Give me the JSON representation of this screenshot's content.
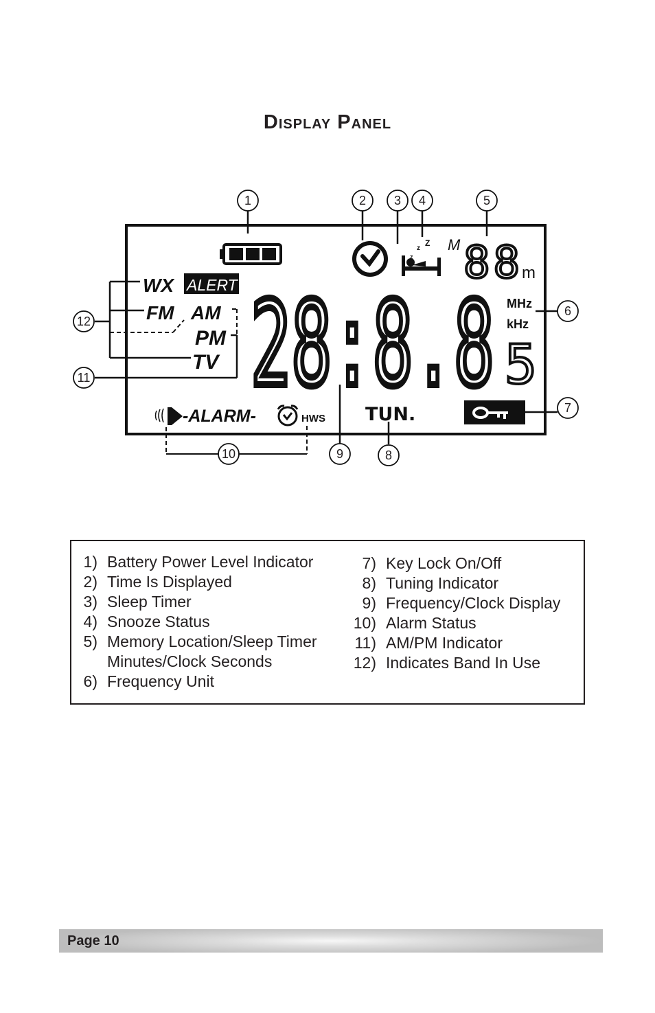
{
  "page": {
    "title": "Display Panel",
    "page_label": "Page 10"
  },
  "lcd": {
    "band_labels": {
      "wx": "WX",
      "alert": "ALERT",
      "fm": "FM",
      "am": "AM",
      "pm": "PM",
      "tv": "TV"
    },
    "main_digits": "28:8.8",
    "sub_digit": "5",
    "memory_prefix": "M",
    "memory_digits": "88",
    "memory_suffix": "m",
    "unit_mhz": "MHz",
    "unit_khz": "kHz",
    "alarm_label": "-ALARM-",
    "hws_label": "HWS",
    "tuning_label": "TUN.",
    "snooze_z": "z z Z",
    "icons": [
      "battery-icon",
      "clock-icon",
      "sleep-bed-icon",
      "speaker-icon",
      "alarm-clock-icon",
      "key-icon"
    ]
  },
  "callouts": [
    "1",
    "2",
    "3",
    "4",
    "5",
    "6",
    "7",
    "8",
    "9",
    "10",
    "11",
    "12"
  ],
  "legend": {
    "left": [
      {
        "num": "1)",
        "text": "Battery Power Level Indicator"
      },
      {
        "num": "2)",
        "text": "Time Is Displayed"
      },
      {
        "num": "3)",
        "text": "Sleep Timer"
      },
      {
        "num": "4)",
        "text": "Snooze Status"
      },
      {
        "num": "5)",
        "text": "Memory Location/Sleep Timer"
      },
      {
        "num": "",
        "text": "Minutes/Clock Seconds"
      },
      {
        "num": "6)",
        "text": "Frequency Unit"
      }
    ],
    "right": [
      {
        "num": "7)",
        "text": "Key Lock On/Off"
      },
      {
        "num": "8)",
        "text": "Tuning Indicator"
      },
      {
        "num": "9)",
        "text": "Frequency/Clock Display"
      },
      {
        "num": "10)",
        "text": "Alarm Status"
      },
      {
        "num": "11)",
        "text": "AM/PM Indicator"
      },
      {
        "num": "12)",
        "text": "Indicates Band In Use"
      }
    ]
  }
}
